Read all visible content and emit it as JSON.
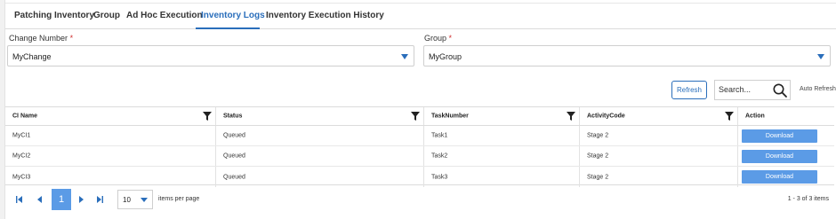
{
  "tabs": [
    {
      "label": "Patching Inventory"
    },
    {
      "label": "Group"
    },
    {
      "label": "Ad Hoc Execution"
    },
    {
      "label": "Inventory Logs"
    },
    {
      "label": "Inventory Execution History"
    }
  ],
  "active_tab": "Inventory Logs",
  "filters": {
    "change_number": {
      "label": "Change Number",
      "required_mark": "*",
      "value": "MyChange"
    },
    "group": {
      "label": "Group",
      "required_mark": "*",
      "value": "MyGroup"
    }
  },
  "toolbar": {
    "refresh_label": "Refresh",
    "search_placeholder": "Search...",
    "auto_refresh_label": "Auto Refresh"
  },
  "grid": {
    "columns": [
      "CI Name",
      "Status",
      "TaskNumber",
      "ActivityCode",
      "Action"
    ],
    "rows": [
      {
        "ci_name": "MyCI1",
        "status": "Queued",
        "task": "Task1",
        "activity": "Stage 2",
        "action": "Download"
      },
      {
        "ci_name": "MyCI2",
        "status": "Queued",
        "task": "Task2",
        "activity": "Stage 2",
        "action": "Download"
      },
      {
        "ci_name": "MyCI3",
        "status": "Queued",
        "task": "Task3",
        "activity": "Stage 2",
        "action": "Download"
      }
    ]
  },
  "pager": {
    "current_page": "1",
    "page_size": "10",
    "items_per_page_label": "items per page",
    "range_text": "1 - 3 of 3 items"
  },
  "colors": {
    "accent": "#2a6ebb",
    "button": "#5b9be6"
  }
}
